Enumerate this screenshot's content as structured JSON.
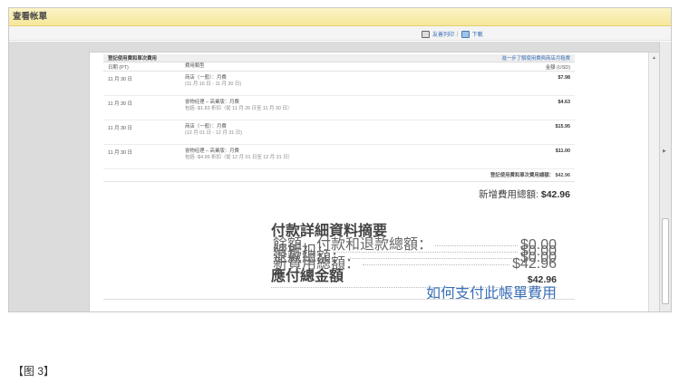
{
  "window": {
    "title": "查看帐單"
  },
  "actions": {
    "print_label": "友善列印",
    "separator": "|",
    "download_label": "下載"
  },
  "statement": {
    "header_title": "登記使用費和單次費用",
    "header_link": "進一步了解使用費與商店月租費",
    "columns": {
      "date": "日期 (PT)",
      "type": "費用類型",
      "amount": "金額 (USD)"
    },
    "rows": [
      {
        "date": "11 月 30 日",
        "type": "商店（一般）：月費",
        "sub": "(11 月 16 日 - 11 月 30 日)",
        "amount": "$7.98"
      },
      {
        "date": "11 月 30 日",
        "type": "會物经理 – 高業版：月費",
        "sub": "包括 -$1.83 折扣（從 11 月 26 日至 11 月 30 日）",
        "amount": "$4.63"
      },
      {
        "date": "11 月 30 日",
        "type": "商店（一般）：月費",
        "sub": "(12 月 01 日 - 12 月 31 日)",
        "amount": "$15.95"
      },
      {
        "date": "11 月 30 日",
        "type": "會物经理 – 高業版：月費",
        "sub": "包括 -$4.99 折扣（從 12 月 01 日至 12 月 31 日）",
        "amount": "$11.00"
      }
    ],
    "subtotal_label": "登記使用費和單次費用總額：",
    "subtotal_value": "$42.96",
    "new_total_label": "新增費用總額:",
    "new_total_value": "$42.96"
  },
  "breakdown": {
    "title": "付款詳細資料摘要",
    "rows": [
      {
        "label": "餘額，付款和退款總額：",
        "value": "$0.00"
      },
      {
        "label": "總折扣：",
        "value": "$0.00"
      },
      {
        "label": "退款總額：",
        "value": "$0.00"
      },
      {
        "label": "新費用總額：",
        "value": "$42.96"
      }
    ],
    "due_label": "應付總金額",
    "due_value": "$42.96",
    "pay_link": "如何支付此帳單費用"
  },
  "caption": "【图 3】"
}
